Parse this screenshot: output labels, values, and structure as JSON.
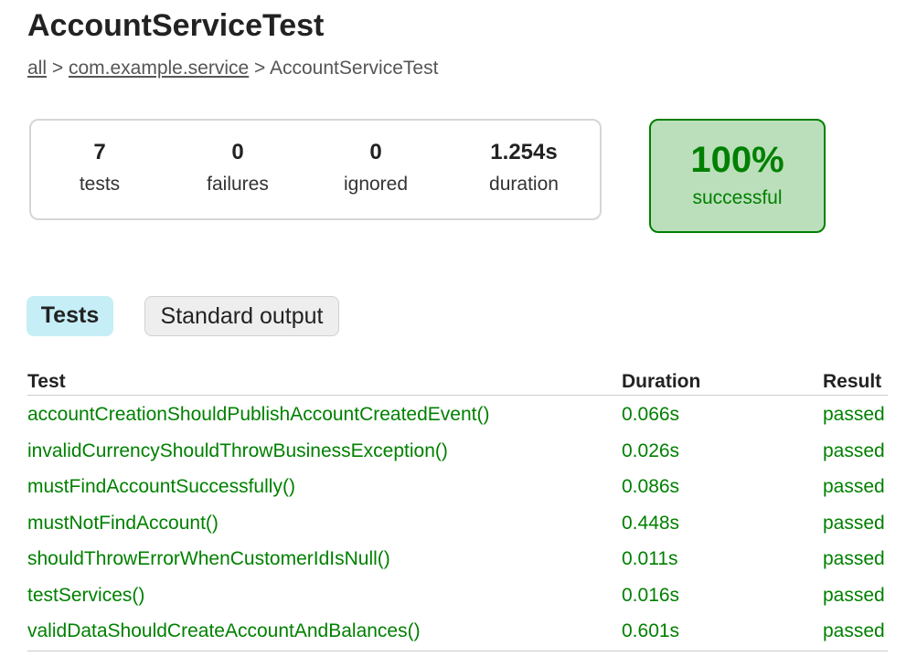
{
  "page": {
    "title": "AccountServiceTest"
  },
  "breadcrumb": {
    "items": [
      {
        "label": "all",
        "link": true
      },
      {
        "label": "com.example.service",
        "link": true
      },
      {
        "label": "AccountServiceTest",
        "link": false
      }
    ],
    "separator": ">"
  },
  "summary": {
    "counters": [
      {
        "value": "7",
        "label": "tests"
      },
      {
        "value": "0",
        "label": "failures"
      },
      {
        "value": "0",
        "label": "ignored"
      },
      {
        "value": "1.254s",
        "label": "duration"
      }
    ],
    "success_rate": "100%",
    "success_label": "successful"
  },
  "tabs": [
    {
      "label": "Tests",
      "selected": true
    },
    {
      "label": "Standard output",
      "selected": false
    }
  ],
  "table": {
    "headers": [
      "Test",
      "Duration",
      "Result"
    ],
    "rows": [
      {
        "test": "accountCreationShouldPublishAccountCreatedEvent()",
        "duration": "0.066s",
        "result": "passed"
      },
      {
        "test": "invalidCurrencyShouldThrowBusinessException()",
        "duration": "0.026s",
        "result": "passed"
      },
      {
        "test": "mustFindAccountSuccessfully()",
        "duration": "0.086s",
        "result": "passed"
      },
      {
        "test": "mustNotFindAccount()",
        "duration": "0.448s",
        "result": "passed"
      },
      {
        "test": "shouldThrowErrorWhenCustomerIdIsNull()",
        "duration": "0.011s",
        "result": "passed"
      },
      {
        "test": "testServices()",
        "duration": "0.016s",
        "result": "passed"
      },
      {
        "test": "validDataShouldCreateAccountAndBalances()",
        "duration": "0.601s",
        "result": "passed"
      }
    ]
  },
  "colors": {
    "success": "#008000",
    "success_bg": "#bbdfbb",
    "selected_tab_bg": "#c6eef6",
    "tab_bg": "#eeeeee"
  }
}
